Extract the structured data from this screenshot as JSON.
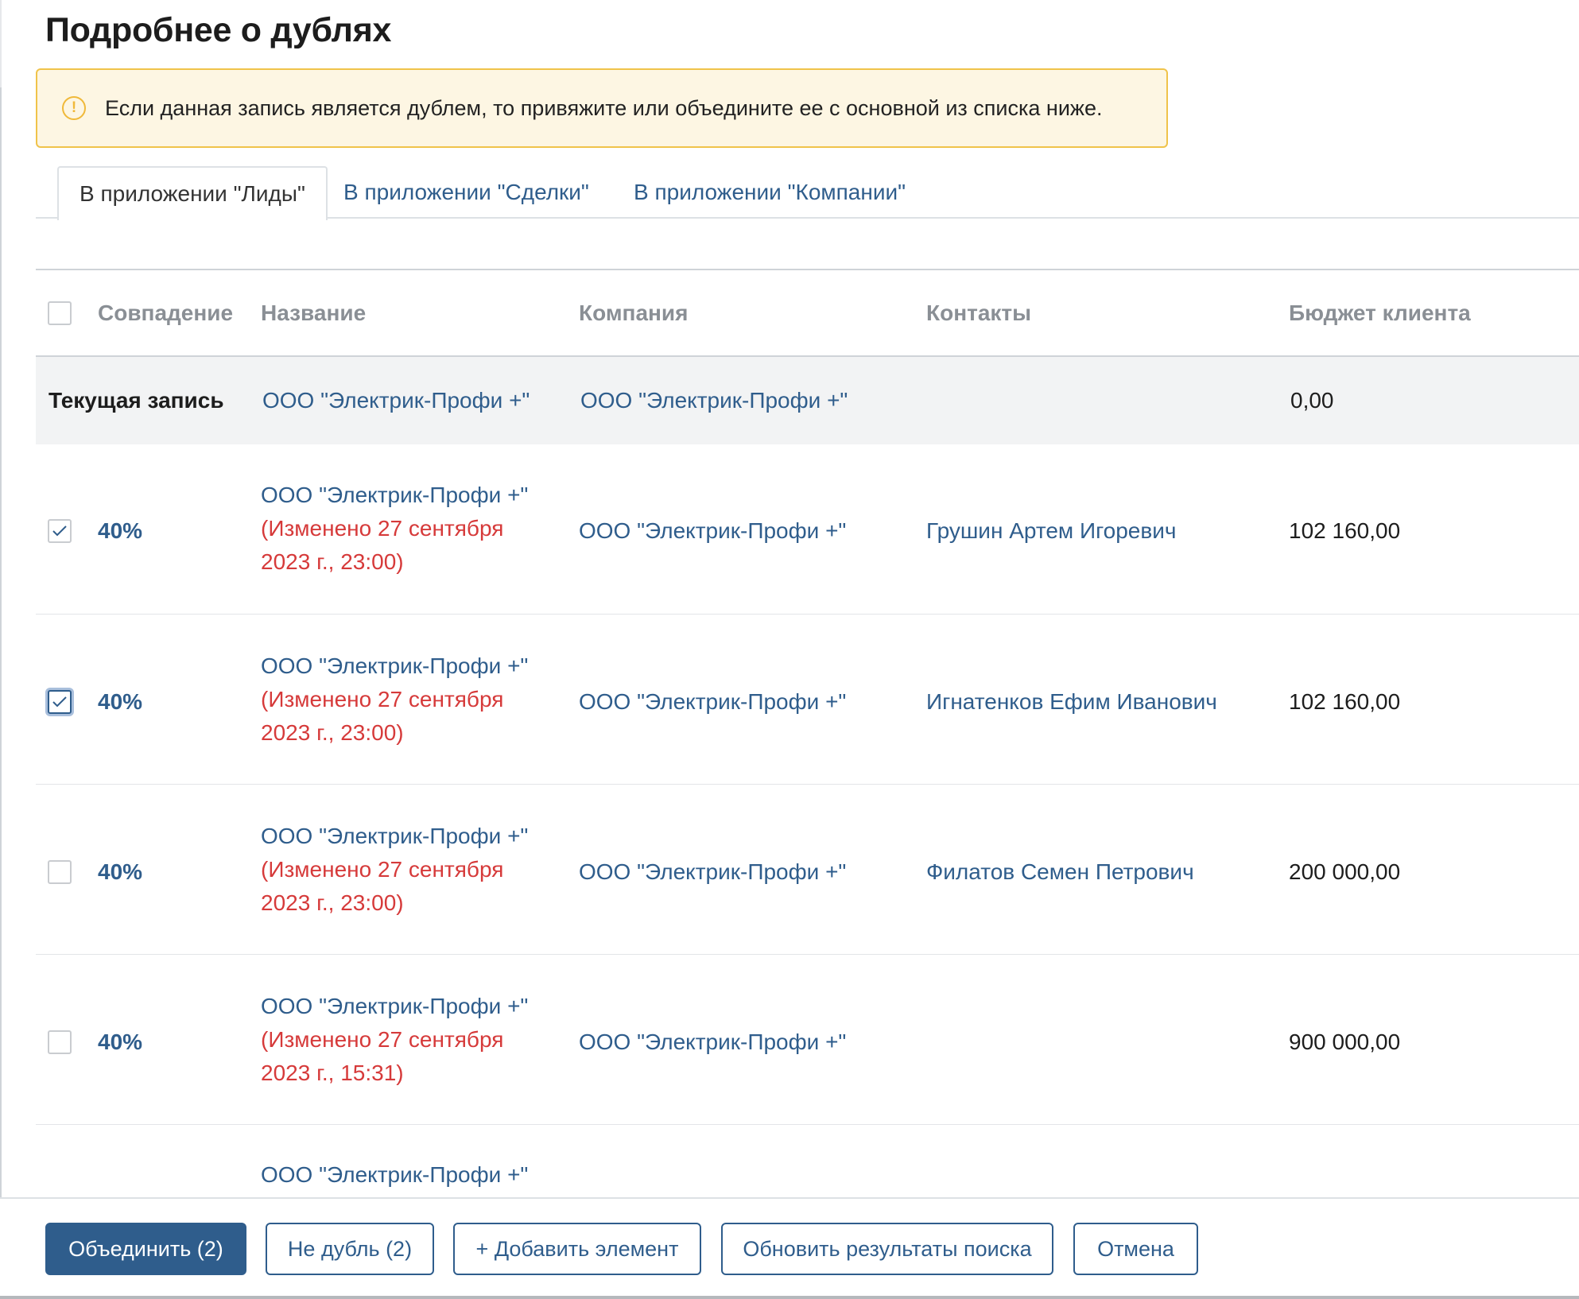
{
  "page": {
    "title": "Подробнее о дублях"
  },
  "alert": {
    "text": "Если данная запись является дублем, то привяжите или объедините ее с основной из списка ниже.",
    "icon": "warning-icon"
  },
  "tabs": [
    {
      "label": "В приложении \"Лиды\"",
      "active": true
    },
    {
      "label": "В приложении \"Сделки\"",
      "active": false
    },
    {
      "label": "В приложении \"Компании\"",
      "active": false
    }
  ],
  "table": {
    "headers": {
      "match": "Совпадение",
      "name": "Название",
      "company": "Компания",
      "contacts": "Контакты",
      "budget": "Бюджет клиента"
    },
    "current": {
      "label": "Текущая запись",
      "name": "ООО \"Электрик-Профи +\"",
      "company": "ООО \"Электрик-Профи +\"",
      "contacts": "",
      "budget": "0,00"
    },
    "rows": [
      {
        "checked": true,
        "match": "40%",
        "name": "ООО \"Электрик-Профи +\"",
        "modified_1": "(Изменено 27 сентября",
        "modified_2": "2023 г., 23:00)",
        "company": "ООО \"Электрик-Профи +\"",
        "contacts": "Грушин Артем Игоревич",
        "budget": "102 160,00"
      },
      {
        "checked": true,
        "match": "40%",
        "name": "ООО \"Электрик-Профи +\"",
        "modified_1": "(Изменено 27 сентября",
        "modified_2": "2023 г., 23:00)",
        "company": "ООО \"Электрик-Профи +\"",
        "contacts": "Игнатенков Ефим Иванович",
        "budget": "102 160,00"
      },
      {
        "checked": false,
        "match": "40%",
        "name": "ООО \"Электрик-Профи +\"",
        "modified_1": "(Изменено 27 сентября",
        "modified_2": "2023 г., 23:00)",
        "company": "ООО \"Электрик-Профи +\"",
        "contacts": "Филатов Семен Петрович",
        "budget": "200 000,00"
      },
      {
        "checked": false,
        "match": "40%",
        "name": "ООО \"Электрик-Профи +\"",
        "modified_1": "(Изменено 27 сентября",
        "modified_2": "2023 г., 15:31)",
        "company": "ООО \"Электрик-Профи +\"",
        "contacts": "",
        "budget": "900 000,00"
      }
    ],
    "partial_row": {
      "name": "ООО \"Электрик-Профи +\""
    }
  },
  "footer": {
    "merge": "Объединить (2)",
    "not_duplicate": "Не дубль (2)",
    "add_element": "+ Добавить элемент",
    "refresh": "Обновить результаты поиска",
    "cancel": "Отмена"
  },
  "colors": {
    "link": "#2f5d8c",
    "modified": "#d63a3a",
    "alert_bg": "#fdf6e3",
    "alert_border": "#f0c34a"
  }
}
